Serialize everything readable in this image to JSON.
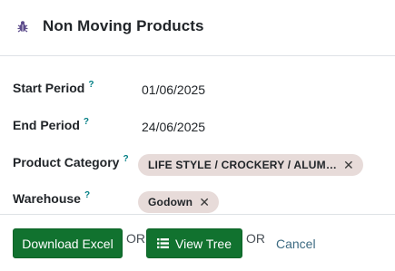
{
  "dialog": {
    "title": "Non Moving Products",
    "icon": "bug-icon"
  },
  "form": {
    "start_period": {
      "label": "Start Period",
      "help": "?",
      "value": "01/06/2025"
    },
    "end_period": {
      "label": "End Period",
      "help": "?",
      "value": "24/06/2025"
    },
    "product_category": {
      "label": "Product Category",
      "help": "?",
      "tags": [
        "LIFE STYLE / CROCKERY / ALUM…"
      ]
    },
    "warehouse": {
      "label": "Warehouse",
      "help": "?",
      "tags": [
        "Godown"
      ]
    }
  },
  "footer": {
    "download_excel_label": "Download Excel",
    "or_1": "OR",
    "view_tree_label": "View Tree",
    "or_2": "OR",
    "cancel_label": "Cancel"
  },
  "colors": {
    "primary_button": "#11722f",
    "tag_background": "#e7dbd9",
    "help_mark": "#017e84",
    "cancel_link": "#3d6b82",
    "icon_purple": "#5b4a8a"
  }
}
